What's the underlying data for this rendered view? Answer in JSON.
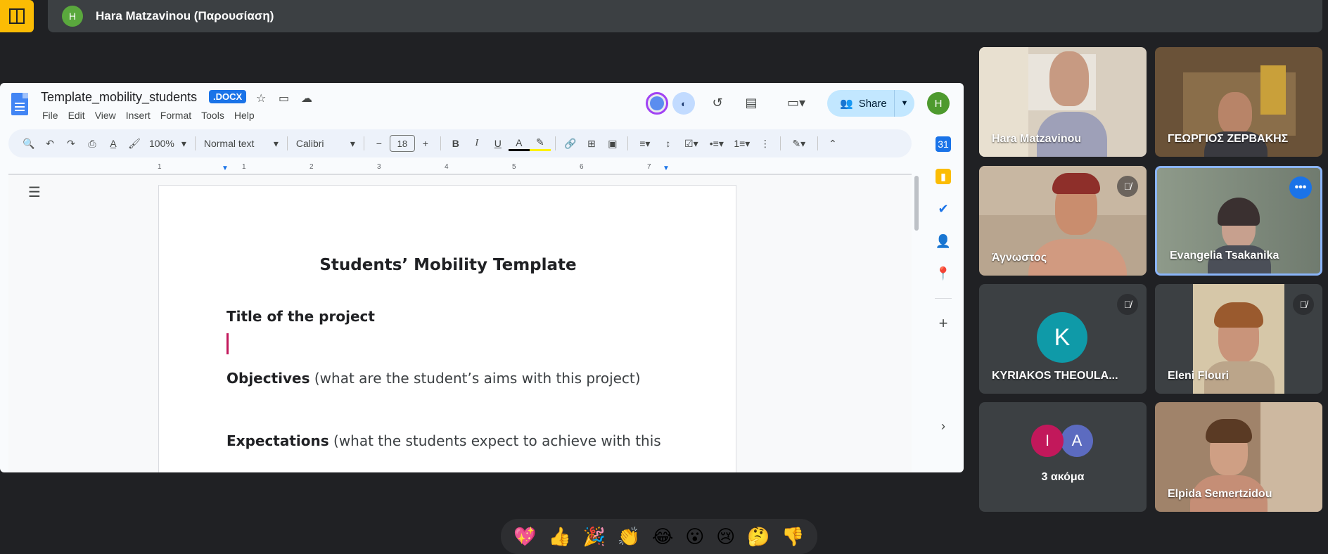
{
  "top_bar": {
    "presenter_initial": "H",
    "presenter_label": "Hara Matzavinou (Παρουσίαση)"
  },
  "doc": {
    "title": "Template_mobility_students",
    "badge": ".DOCX",
    "menu": [
      "File",
      "Edit",
      "View",
      "Insert",
      "Format",
      "Tools",
      "Help"
    ],
    "share_label": "Share",
    "user_initial": "H",
    "toolbar": {
      "zoom": "100%",
      "style": "Normal text",
      "font": "Calibri",
      "font_size": "18"
    },
    "ruler_numbers": [
      "1",
      "1",
      "2",
      "3",
      "4",
      "5",
      "6",
      "7"
    ],
    "content": {
      "heading": "Students’ Mobility Template",
      "p1_bold": "Title of the project",
      "p2_bold": "Objectives",
      "p2_rest": " (what are the student’s aims with this project)",
      "p3_bold": "Expectations",
      "p3_rest": " (what the students expect to achieve with this"
    }
  },
  "participants": [
    {
      "name": "Hara Matzavinou",
      "muted": false
    },
    {
      "name": "ΓΕΩΡΓΙΟΣ ΖΕΡΒΑΚΗΣ",
      "muted": false
    },
    {
      "name": "Άγνωστος",
      "muted": true
    },
    {
      "name": "Evangelia Tsakanika",
      "muted": false,
      "active_speaker": true
    },
    {
      "name": "KYRIAKOS THEOULA...",
      "muted": true,
      "initial": "K"
    },
    {
      "name": "Eleni Flouri",
      "muted": true
    },
    {
      "name": "3 ακόμα",
      "initials": [
        "I",
        "A"
      ]
    },
    {
      "name": "Elpida Semertzidou",
      "muted": false
    }
  ],
  "reactions": [
    "💖",
    "👍",
    "🎉",
    "👏",
    "😂",
    "😮",
    "😢",
    "🤔",
    "👎"
  ],
  "colors": {
    "accent": "#1a73e8",
    "dock_yellow": "#fbbc04",
    "share_bg": "#c2e7ff"
  }
}
